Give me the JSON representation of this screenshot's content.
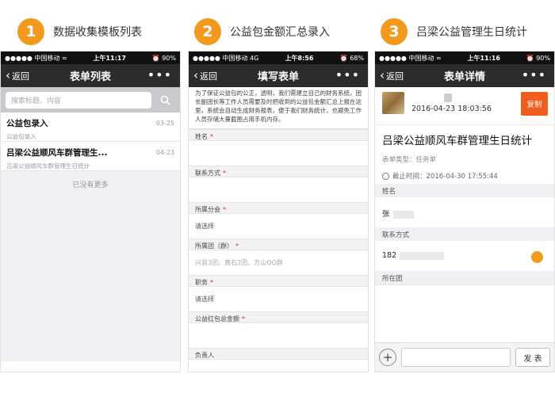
{
  "accent_color": "#f39a1e",
  "steps": [
    {
      "num": "1",
      "title": "数据收集模板列表"
    },
    {
      "num": "2",
      "title": "公益包金额汇总录入"
    },
    {
      "num": "3",
      "title": "吕梁公益管理生日统计"
    }
  ],
  "phone1": {
    "status": {
      "left": "●●●●● 中国移动 ≈",
      "time": "上午11:17",
      "right": "⏰ 90%"
    },
    "nav": {
      "back": "返回",
      "title": "表单列表",
      "more": "•••"
    },
    "search_placeholder": "搜索标题、内容",
    "items": [
      {
        "title": "公益包录入",
        "sub": "公益包录入",
        "date": "03-25"
      },
      {
        "title": "吕梁公益顺风车群管理生...",
        "sub": "吕梁公益顺风车群管理生日统计",
        "date": "04-23"
      }
    ],
    "no_more": "已没有更多"
  },
  "phone2": {
    "status": {
      "left": "●●●●● 中国移动 4G",
      "time": "上午8:56",
      "right": "⏰ 68%"
    },
    "nav": {
      "back": "返回",
      "title": "填写表单",
      "more": "•••"
    },
    "intro": "为了保证公益包的公正，透明，我们需建立自己的财务系统，团长副团长等工作人员需要及时把收到的公益包金额汇总上报在这里，系统会自动生成财务报表，便于我们财务统计，也避免工作人员存储大量截图占用手机内存。",
    "fields": [
      {
        "label": "姓名",
        "required": "*",
        "value": ""
      },
      {
        "label": "联系方式",
        "required": "*",
        "value": ""
      },
      {
        "label": "所属分会",
        "required": "*",
        "value": "请选择"
      },
      {
        "label": "所属团（群）",
        "required": "*",
        "value": "兴县3团、离石2团、方山QQ群"
      },
      {
        "label": "职务",
        "required": "*",
        "value": "请选择"
      },
      {
        "label": "公益红包总金额",
        "required": "*",
        "value": ""
      },
      {
        "label": "负责人",
        "required": "",
        "value": ""
      }
    ]
  },
  "phone3": {
    "status": {
      "left": "●●●●● 中国移动 ≈",
      "time": "上午11:16",
      "right": "⏰ 90%"
    },
    "nav": {
      "back": "返回",
      "title": "表单详情",
      "more": "•••"
    },
    "datetime": "2016-04-23 18:03:56",
    "copy_label": "复制",
    "title": "吕梁公益顺风车群管理生日统计",
    "type_label": "表单类型：任务单",
    "deadline": "截止时间：2016-04-30 17:55:44",
    "fields": [
      {
        "label": "姓名",
        "value": "张"
      },
      {
        "label": "联系方式",
        "value": "182"
      },
      {
        "label": "所在团",
        "value": ""
      }
    ],
    "send_label": "发 表"
  }
}
